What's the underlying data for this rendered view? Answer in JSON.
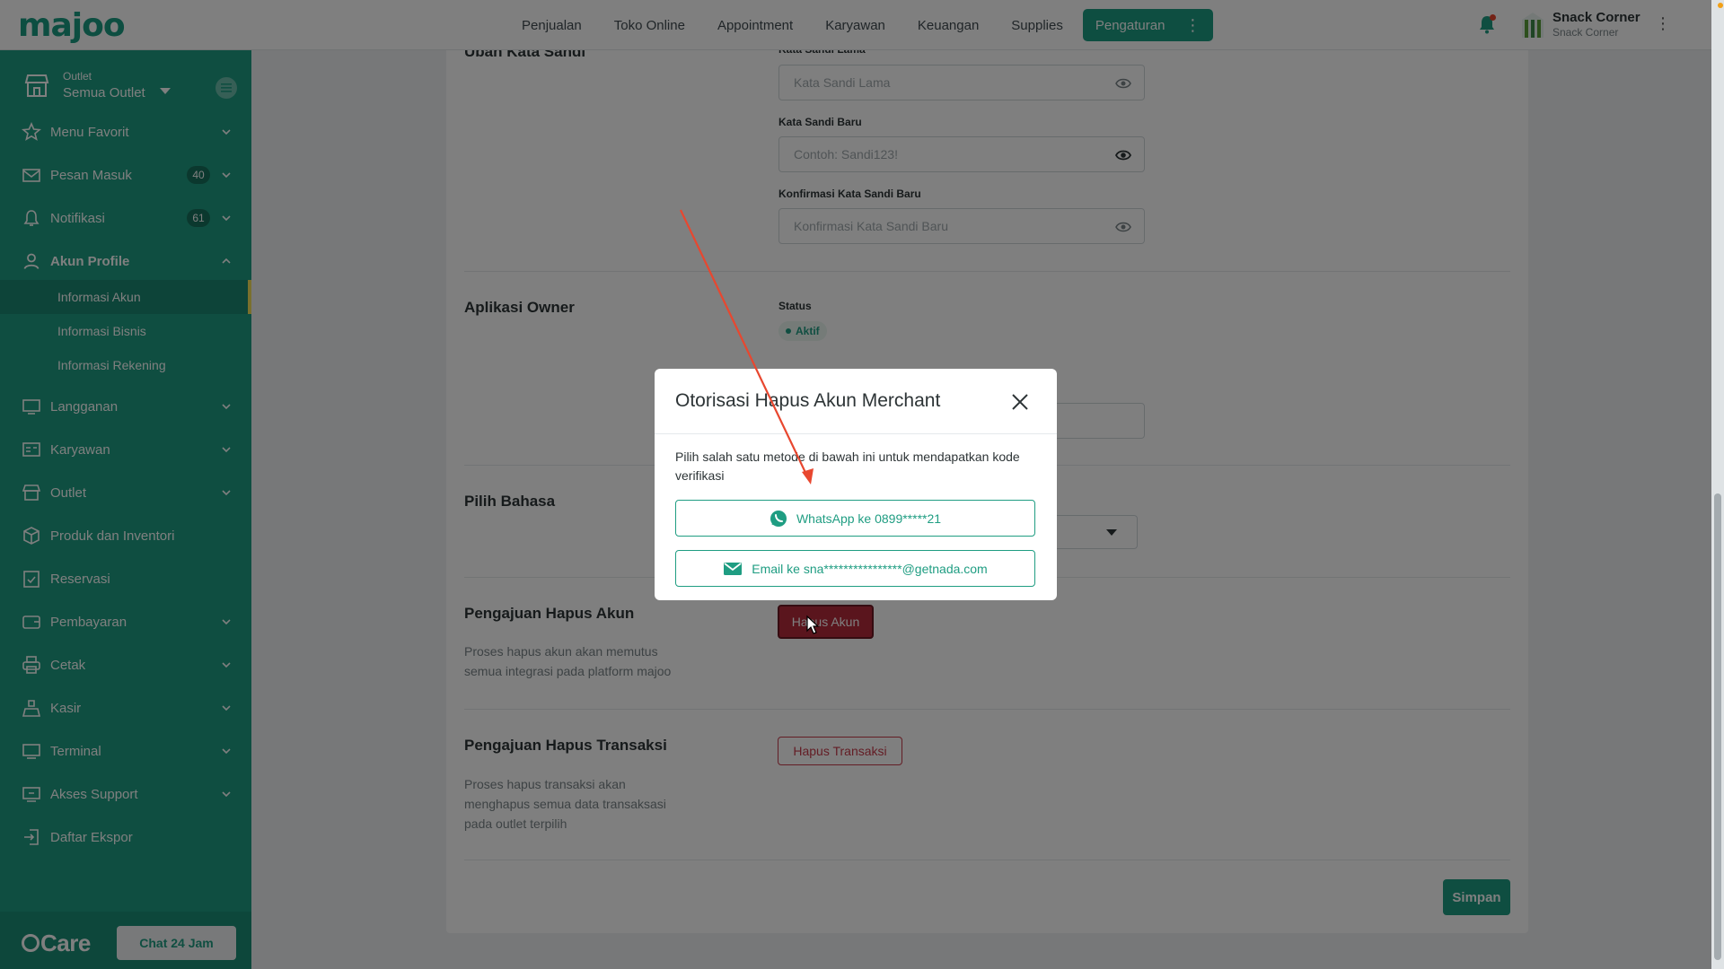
{
  "brand": {
    "logo": "majoo",
    "accent": "#1f9d82"
  },
  "topnav": {
    "items": [
      "Penjualan",
      "Toko Online",
      "Appointment",
      "Karyawan",
      "Keuangan",
      "Supplies"
    ],
    "active": "Pengaturan"
  },
  "user": {
    "store_name": "Snack Corner",
    "store_sub": "Snack Corner"
  },
  "sidebar": {
    "outlet_label": "Outlet",
    "outlet_value": "Semua Outlet",
    "menu": [
      {
        "label": "Menu Favorit",
        "icon": "star-icon"
      },
      {
        "label": "Pesan Masuk",
        "icon": "mail-icon",
        "badge": "40"
      },
      {
        "label": "Notifikasi",
        "icon": "bell-icon",
        "badge": "61"
      },
      {
        "label": "Akun Profile",
        "icon": "user-icon"
      },
      {
        "label": "Langganan",
        "icon": "monitor-icon"
      },
      {
        "label": "Karyawan",
        "icon": "id-card-icon"
      },
      {
        "label": "Outlet",
        "icon": "store-icon"
      },
      {
        "label": "Produk dan Inventori",
        "icon": "box-icon"
      },
      {
        "label": "Reservasi",
        "icon": "calendar-check-icon"
      },
      {
        "label": "Pembayaran",
        "icon": "wallet-icon"
      },
      {
        "label": "Cetak",
        "icon": "printer-icon"
      },
      {
        "label": "Kasir",
        "icon": "cashier-icon"
      },
      {
        "label": "Terminal",
        "icon": "terminal-icon"
      },
      {
        "label": "Akses Support",
        "icon": "support-icon"
      },
      {
        "label": "Daftar Ekspor",
        "icon": "export-icon"
      }
    ],
    "submenu": [
      "Informasi Akun",
      "Informasi Bisnis",
      "Informasi Rekening"
    ],
    "care_logo": "Care",
    "chat_button": "Chat 24 Jam"
  },
  "content": {
    "password_section_title": "Ubah Kata Sandi",
    "old_password_label": "Kata Sandi Lama",
    "old_password_placeholder": "Kata Sandi Lama",
    "new_password_label": "Kata Sandi Baru",
    "new_password_placeholder": "Contoh: Sandi123!",
    "confirm_password_label": "Konfirmasi Kata Sandi Baru",
    "confirm_password_placeholder": "Konfirmasi Kata Sandi Baru",
    "owner_app_title": "Aplikasi Owner",
    "status_label": "Status",
    "status_value": "Aktif",
    "language_title": "Pilih Bahasa",
    "delete_account_title": "Pengajuan Hapus Akun",
    "delete_account_desc": "Proses hapus akun akan memutus semua integrasi pada platform majoo",
    "delete_account_button": "Hapus Akun",
    "delete_tx_title": "Pengajuan Hapus Transaksi",
    "delete_tx_desc": "Proses hapus transaksi akan menghapus semua data transaksasi pada outlet terpilih",
    "delete_tx_button": "Hapus Transaksi",
    "save_button": "Simpan"
  },
  "modal": {
    "title": "Otorisasi Hapus Akun Merchant",
    "description": "Pilih salah satu metode di bawah ini untuk mendapatkan kode verifikasi",
    "whatsapp_option": "WhatsApp ke 0899*****21",
    "email_option": "Email ke sna****************@getnada.com"
  },
  "colors": {
    "primary": "#1f9d82",
    "danger": "#b52a3a",
    "annotation": "#e8472f"
  }
}
